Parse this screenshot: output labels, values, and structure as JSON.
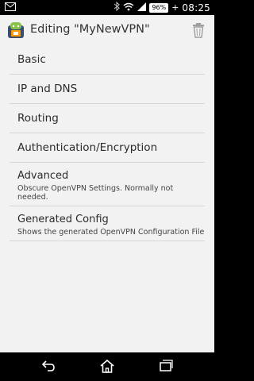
{
  "status_bar": {
    "battery_percent": "96%",
    "charging_symbol": "+",
    "time": "08:25"
  },
  "action_bar": {
    "title": "Editing \"MyNewVPN\""
  },
  "menu": {
    "items": [
      {
        "label": "Basic"
      },
      {
        "label": "IP and DNS"
      },
      {
        "label": "Routing"
      },
      {
        "label": "Authentication/Encryption"
      },
      {
        "label": "Advanced",
        "description": "Obscure OpenVPN Settings. Normally not needed."
      },
      {
        "label": "Generated Config",
        "description": "Shows the generated OpenVPN Configuration File"
      }
    ]
  },
  "nav_bar": {
    "icons": [
      "back-icon",
      "home-icon",
      "recent-apps-icon"
    ]
  }
}
